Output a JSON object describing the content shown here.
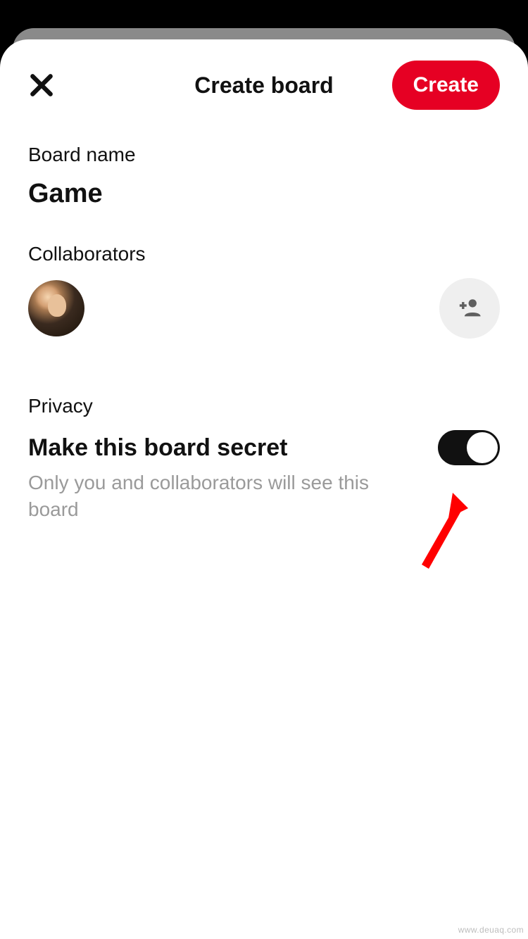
{
  "header": {
    "title": "Create board",
    "create_label": "Create"
  },
  "board_name": {
    "label": "Board name",
    "value": "Game"
  },
  "collaborators": {
    "label": "Collaborators"
  },
  "privacy": {
    "label": "Privacy",
    "toggle_title": "Make this board secret",
    "toggle_desc": "Only you and collaborators will see this board",
    "toggle_on": true
  },
  "colors": {
    "accent": "#e60023"
  },
  "watermark": "www.deuaq.com"
}
